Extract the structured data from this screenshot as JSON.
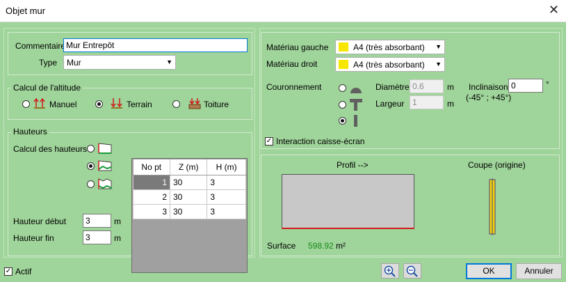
{
  "window": {
    "title": "Objet mur",
    "close_glyph": "✕"
  },
  "general": {
    "commentaire_label": "Commentaire",
    "commentaire_value": "Mur Entrepôt",
    "type_label": "Type",
    "type_value": "Mur"
  },
  "altitude": {
    "group_label": "Calcul de l'altitude",
    "options": [
      {
        "label": "Manuel",
        "selected": false,
        "icon": "manual-altitude-icon"
      },
      {
        "label": "Terrain",
        "selected": true,
        "icon": "terrain-altitude-icon"
      },
      {
        "label": "Toiture",
        "selected": false,
        "icon": "roof-altitude-icon"
      }
    ]
  },
  "hauteurs": {
    "group_label": "Hauteurs",
    "calc_label": "Calcul des hauteurs",
    "calc_options_selected": 1,
    "table": {
      "headers": [
        "No pt",
        "Z (m)",
        "H (m)"
      ],
      "rows": [
        {
          "no": "1",
          "z": "30",
          "h": "3"
        },
        {
          "no": "2",
          "z": "30",
          "h": "3"
        },
        {
          "no": "3",
          "z": "30",
          "h": "3"
        }
      ]
    },
    "debut_label": "Hauteur début",
    "debut_value": "3",
    "fin_label": "Hauteur fin",
    "fin_value": "3",
    "unit": "m"
  },
  "materials": {
    "left_label": "Matériau gauche",
    "left_value": "A4 (très absorbant)",
    "right_label": "Matériau droit",
    "right_value": "A4 (très absorbant)",
    "swatch_color": "#f7e600"
  },
  "couronnement": {
    "label": "Couronnement",
    "selected": 2,
    "diametre_label": "Diamètre",
    "diametre_value": "0.6",
    "largeur_label": "Largeur",
    "largeur_value": "1",
    "unit": "m",
    "inclinaison_label": "Inclinaison",
    "inclinaison_value": "0",
    "inclinaison_unit": "°",
    "inclinaison_range": "(-45° ; +45°)"
  },
  "interaction": {
    "label": "Interaction caisse-écran",
    "checked": true
  },
  "preview": {
    "profil_label": "Profil  -->",
    "coupe_label": "Coupe (origine)",
    "surface_label": "Surface",
    "surface_value": "598.92",
    "surface_unit": "m²",
    "surface_color": "#1a8a1a"
  },
  "footer": {
    "actif_label": "Actif",
    "actif_checked": true,
    "ok_label": "OK",
    "cancel_label": "Annuler"
  }
}
